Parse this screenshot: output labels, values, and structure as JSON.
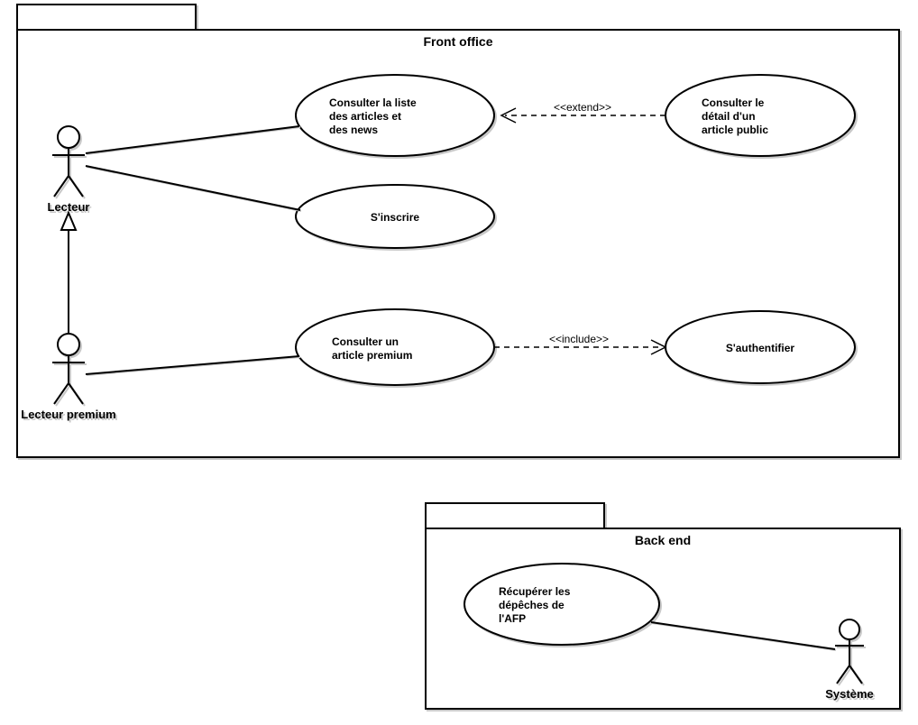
{
  "packages": {
    "front": {
      "title": "Front office"
    },
    "back": {
      "title": "Back end"
    }
  },
  "actors": {
    "lecteur": {
      "label": "Lecteur"
    },
    "lecteurPremium": {
      "label": "Lecteur premium"
    },
    "systeme": {
      "label": "Système"
    }
  },
  "usecases": {
    "consulterListe": {
      "line1": "Consulter la liste",
      "line2": "des articles et",
      "line3": "des news"
    },
    "consulterDetail": {
      "line1": "Consulter le",
      "line2": "détail d'un",
      "line3": "article public"
    },
    "sinscrire": {
      "line1": "S'inscrire"
    },
    "consulterPremium": {
      "line1": "Consulter un",
      "line2": "article premium"
    },
    "sauthentifier": {
      "line1": "S'authentifier"
    },
    "recupererDepeches": {
      "line1": "Récupérer les",
      "line2": "dépêches de",
      "line3": "l'AFP"
    }
  },
  "relations": {
    "extend": {
      "label": "<<extend>>"
    },
    "include": {
      "label": "<<include>>"
    }
  }
}
